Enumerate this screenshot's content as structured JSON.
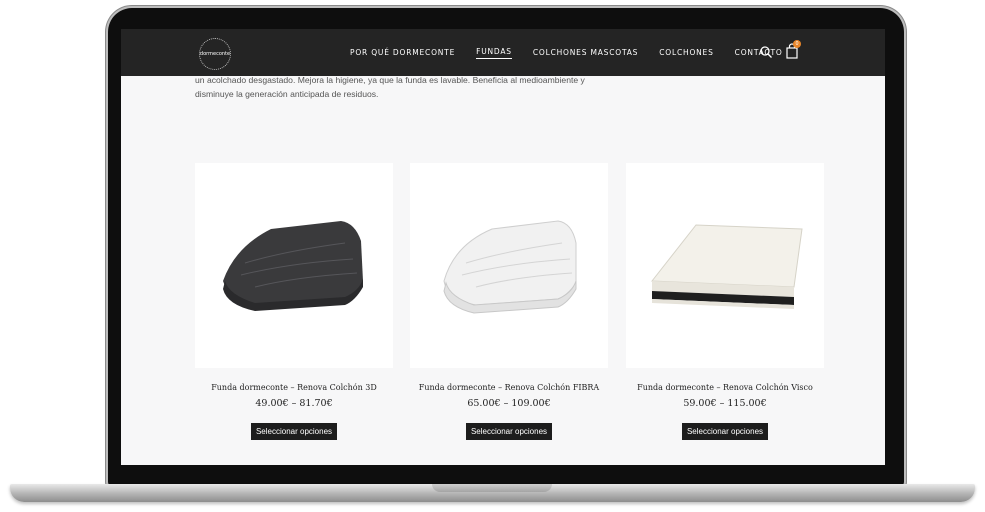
{
  "nav": {
    "logo_text": "dormeconte",
    "items": [
      {
        "label": "POR QUÉ DORMECONTE",
        "active": false
      },
      {
        "label": "FUNDAS",
        "active": true
      },
      {
        "label": "COLCHONES MASCOTAS",
        "active": false
      },
      {
        "label": "COLCHONES",
        "active": false
      },
      {
        "label": "CONTACTO",
        "active": false
      }
    ],
    "search_icon": "search-icon",
    "cart_icon": "shopping-bag-icon",
    "cart_count": "0",
    "accent_color": "#e8862a"
  },
  "intro": {
    "line1": "un acolchado desgastado. Mejora la higiene, ya que la funda es lavable. Beneficia al medioambiente y",
    "line2": "disminuye la generación anticipada de residuos."
  },
  "products": [
    {
      "title": "Funda dormeconte – Renova Colchón 3D",
      "price": "49.00€ – 81.70€",
      "button": "Seleccionar opciones",
      "image": "dark-grey-folded-mattress-topper"
    },
    {
      "title": "Funda dormeconte – Renova Colchón FIBRA",
      "price": "65.00€ – 109.00€",
      "button": "Seleccionar opciones",
      "image": "white-folded-mattress-topper"
    },
    {
      "title": "Funda dormeconte – Renova Colchón Visco",
      "price": "59.00€ – 115.00€",
      "button": "Seleccionar opciones",
      "image": "white-visco-mattress"
    }
  ]
}
